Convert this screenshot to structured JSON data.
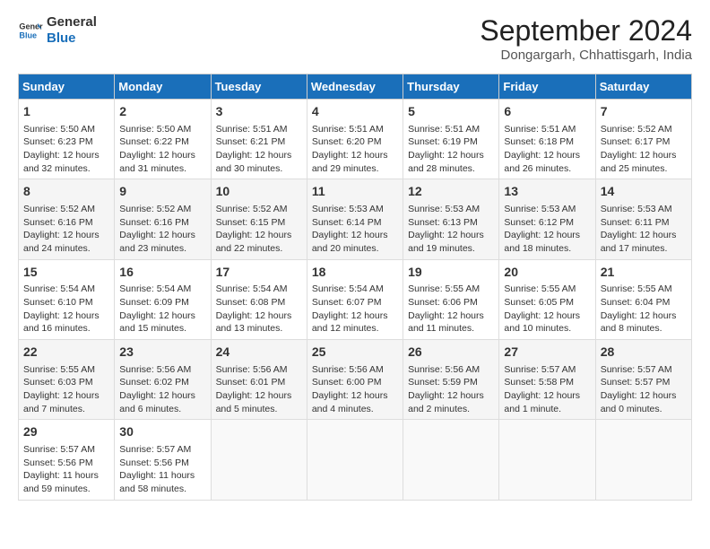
{
  "header": {
    "logo_line1": "General",
    "logo_line2": "Blue",
    "month": "September 2024",
    "location": "Dongargarh, Chhattisgarh, India"
  },
  "days_of_week": [
    "Sunday",
    "Monday",
    "Tuesday",
    "Wednesday",
    "Thursday",
    "Friday",
    "Saturday"
  ],
  "weeks": [
    [
      {
        "day": "1",
        "info": "Sunrise: 5:50 AM\nSunset: 6:23 PM\nDaylight: 12 hours\nand 32 minutes."
      },
      {
        "day": "2",
        "info": "Sunrise: 5:50 AM\nSunset: 6:22 PM\nDaylight: 12 hours\nand 31 minutes."
      },
      {
        "day": "3",
        "info": "Sunrise: 5:51 AM\nSunset: 6:21 PM\nDaylight: 12 hours\nand 30 minutes."
      },
      {
        "day": "4",
        "info": "Sunrise: 5:51 AM\nSunset: 6:20 PM\nDaylight: 12 hours\nand 29 minutes."
      },
      {
        "day": "5",
        "info": "Sunrise: 5:51 AM\nSunset: 6:19 PM\nDaylight: 12 hours\nand 28 minutes."
      },
      {
        "day": "6",
        "info": "Sunrise: 5:51 AM\nSunset: 6:18 PM\nDaylight: 12 hours\nand 26 minutes."
      },
      {
        "day": "7",
        "info": "Sunrise: 5:52 AM\nSunset: 6:17 PM\nDaylight: 12 hours\nand 25 minutes."
      }
    ],
    [
      {
        "day": "8",
        "info": "Sunrise: 5:52 AM\nSunset: 6:16 PM\nDaylight: 12 hours\nand 24 minutes."
      },
      {
        "day": "9",
        "info": "Sunrise: 5:52 AM\nSunset: 6:16 PM\nDaylight: 12 hours\nand 23 minutes."
      },
      {
        "day": "10",
        "info": "Sunrise: 5:52 AM\nSunset: 6:15 PM\nDaylight: 12 hours\nand 22 minutes."
      },
      {
        "day": "11",
        "info": "Sunrise: 5:53 AM\nSunset: 6:14 PM\nDaylight: 12 hours\nand 20 minutes."
      },
      {
        "day": "12",
        "info": "Sunrise: 5:53 AM\nSunset: 6:13 PM\nDaylight: 12 hours\nand 19 minutes."
      },
      {
        "day": "13",
        "info": "Sunrise: 5:53 AM\nSunset: 6:12 PM\nDaylight: 12 hours\nand 18 minutes."
      },
      {
        "day": "14",
        "info": "Sunrise: 5:53 AM\nSunset: 6:11 PM\nDaylight: 12 hours\nand 17 minutes."
      }
    ],
    [
      {
        "day": "15",
        "info": "Sunrise: 5:54 AM\nSunset: 6:10 PM\nDaylight: 12 hours\nand 16 minutes."
      },
      {
        "day": "16",
        "info": "Sunrise: 5:54 AM\nSunset: 6:09 PM\nDaylight: 12 hours\nand 15 minutes."
      },
      {
        "day": "17",
        "info": "Sunrise: 5:54 AM\nSunset: 6:08 PM\nDaylight: 12 hours\nand 13 minutes."
      },
      {
        "day": "18",
        "info": "Sunrise: 5:54 AM\nSunset: 6:07 PM\nDaylight: 12 hours\nand 12 minutes."
      },
      {
        "day": "19",
        "info": "Sunrise: 5:55 AM\nSunset: 6:06 PM\nDaylight: 12 hours\nand 11 minutes."
      },
      {
        "day": "20",
        "info": "Sunrise: 5:55 AM\nSunset: 6:05 PM\nDaylight: 12 hours\nand 10 minutes."
      },
      {
        "day": "21",
        "info": "Sunrise: 5:55 AM\nSunset: 6:04 PM\nDaylight: 12 hours\nand 8 minutes."
      }
    ],
    [
      {
        "day": "22",
        "info": "Sunrise: 5:55 AM\nSunset: 6:03 PM\nDaylight: 12 hours\nand 7 minutes."
      },
      {
        "day": "23",
        "info": "Sunrise: 5:56 AM\nSunset: 6:02 PM\nDaylight: 12 hours\nand 6 minutes."
      },
      {
        "day": "24",
        "info": "Sunrise: 5:56 AM\nSunset: 6:01 PM\nDaylight: 12 hours\nand 5 minutes."
      },
      {
        "day": "25",
        "info": "Sunrise: 5:56 AM\nSunset: 6:00 PM\nDaylight: 12 hours\nand 4 minutes."
      },
      {
        "day": "26",
        "info": "Sunrise: 5:56 AM\nSunset: 5:59 PM\nDaylight: 12 hours\nand 2 minutes."
      },
      {
        "day": "27",
        "info": "Sunrise: 5:57 AM\nSunset: 5:58 PM\nDaylight: 12 hours\nand 1 minute."
      },
      {
        "day": "28",
        "info": "Sunrise: 5:57 AM\nSunset: 5:57 PM\nDaylight: 12 hours\nand 0 minutes."
      }
    ],
    [
      {
        "day": "29",
        "info": "Sunrise: 5:57 AM\nSunset: 5:56 PM\nDaylight: 11 hours\nand 59 minutes."
      },
      {
        "day": "30",
        "info": "Sunrise: 5:57 AM\nSunset: 5:56 PM\nDaylight: 11 hours\nand 58 minutes."
      },
      {
        "day": "",
        "info": ""
      },
      {
        "day": "",
        "info": ""
      },
      {
        "day": "",
        "info": ""
      },
      {
        "day": "",
        "info": ""
      },
      {
        "day": "",
        "info": ""
      }
    ]
  ],
  "colors": {
    "header_bg": "#1a6fba",
    "accent": "#1a6fba"
  }
}
